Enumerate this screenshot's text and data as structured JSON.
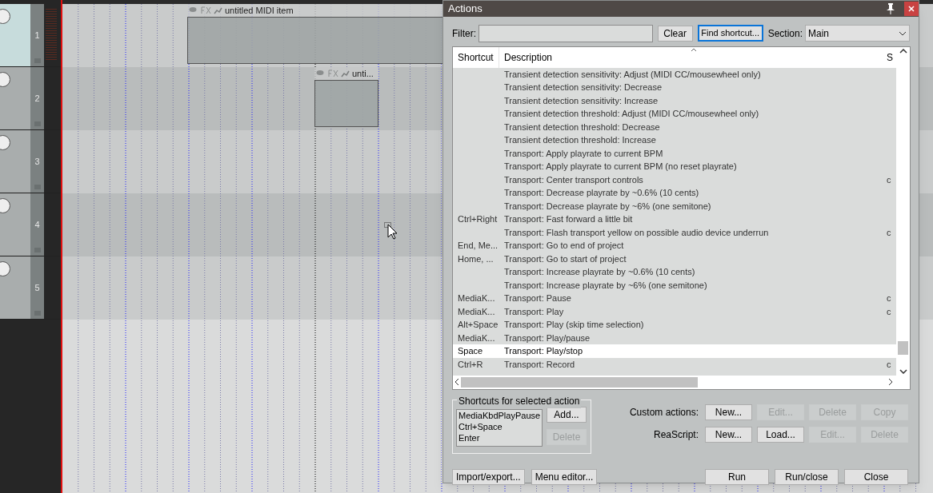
{
  "tracks": [
    {
      "number": "1",
      "selected": true
    },
    {
      "number": "2",
      "selected": false
    },
    {
      "number": "3",
      "selected": false
    },
    {
      "number": "4",
      "selected": false
    },
    {
      "number": "5",
      "selected": false
    }
  ],
  "items": [
    {
      "title": "untitled MIDI item"
    },
    {
      "title": "unti..."
    }
  ],
  "dialog": {
    "title": "Actions",
    "filter": {
      "label": "Filter:"
    },
    "clear": "Clear",
    "find_shortcut": "Find shortcut...",
    "section": {
      "label": "Section:",
      "value": "Main"
    },
    "table": {
      "columns": [
        "Shortcut",
        "Description",
        "S"
      ],
      "rows": [
        {
          "description": "Transient detection sensitivity: Adjust (MIDI CC/mousewheel only)",
          "selected": false
        },
        {
          "description": "Transient detection sensitivity: Decrease",
          "selected": false
        },
        {
          "description": "Transient detection sensitivity: Increase",
          "selected": false
        },
        {
          "description": "Transient detection threshold: Adjust (MIDI CC/mousewheel only)",
          "selected": false
        },
        {
          "description": "Transient detection threshold: Decrease",
          "selected": false
        },
        {
          "description": "Transient detection threshold: Increase",
          "selected": false
        },
        {
          "description": "Transport: Apply playrate to current BPM",
          "selected": false
        },
        {
          "description": "Transport: Apply playrate to current BPM (no reset playrate)",
          "selected": false
        },
        {
          "description": "Transport: Center transport controls",
          "column_3": "c",
          "selected": false
        },
        {
          "description": "Transport: Decrease playrate by ~0.6% (10 cents)",
          "selected": false
        },
        {
          "description": "Transport: Decrease playrate by ~6% (one semitone)",
          "selected": false
        },
        {
          "shortcut": "Ctrl+Right",
          "description": "Transport: Fast forward a little bit",
          "selected": false
        },
        {
          "description": "Transport: Flash transport yellow on possible audio device underrun",
          "column_3": "c",
          "selected": false
        },
        {
          "shortcut": "End, Me...",
          "description": "Transport: Go to end of project",
          "selected": false
        },
        {
          "shortcut": "Home, ...",
          "description": "Transport: Go to start of project",
          "selected": false
        },
        {
          "description": "Transport: Increase playrate by ~0.6% (10 cents)",
          "selected": false
        },
        {
          "description": "Transport: Increase playrate by ~6% (one semitone)",
          "selected": false
        },
        {
          "shortcut": "MediaK...",
          "description": "Transport: Pause",
          "column_3": "c",
          "selected": false
        },
        {
          "shortcut": "MediaK...",
          "description": "Transport: Play",
          "column_3": "c",
          "selected": false
        },
        {
          "shortcut": "Alt+Space",
          "description": "Transport: Play (skip time selection)",
          "selected": false
        },
        {
          "shortcut": "MediaK...",
          "description": "Transport: Play/pause",
          "selected": false
        },
        {
          "shortcut": "Space",
          "description": "Transport: Play/stop",
          "selected": true
        },
        {
          "shortcut": "Ctrl+R",
          "description": "Transport: Record",
          "column_3": "c",
          "selected": false
        }
      ]
    },
    "shortcuts_group": {
      "title": "Shortcuts for selected action",
      "entries": [
        "MediaKbdPlayPause",
        "Ctrl+Space",
        "Enter"
      ],
      "buttons": [
        {
          "label": "Add...",
          "disabled": false
        },
        {
          "label": "Delete",
          "disabled": true
        }
      ]
    },
    "custom_actions": {
      "label": "Custom actions:",
      "buttons": [
        {
          "label": "New...",
          "disabled": false
        },
        {
          "label": "Edit...",
          "disabled": true
        },
        {
          "label": "Delete",
          "disabled": true
        },
        {
          "label": "Copy",
          "disabled": true
        }
      ]
    },
    "reascript": {
      "label": "ReaScript:",
      "buttons": [
        {
          "label": "New...",
          "disabled": false
        },
        {
          "label": "Load...",
          "disabled": false
        },
        {
          "label": "Edit...",
          "disabled": true
        },
        {
          "label": "Delete",
          "disabled": true
        }
      ]
    },
    "bottom_left": [
      "Import/export...",
      "Menu editor..."
    ],
    "bottom_right": [
      "Run",
      "Run/close",
      "Close"
    ]
  }
}
